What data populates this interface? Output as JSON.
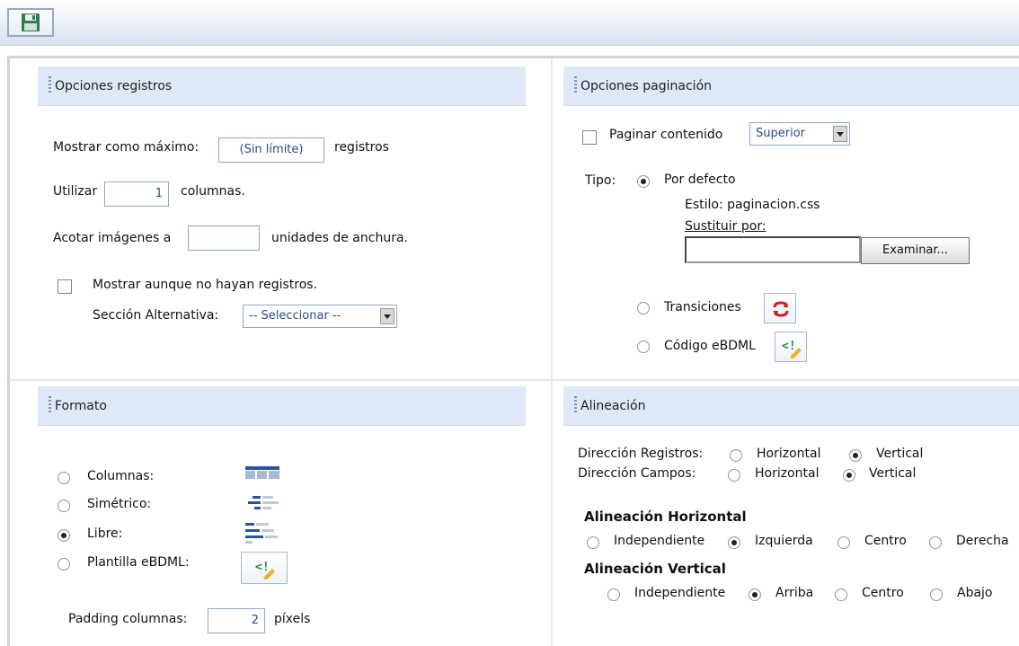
{
  "colors": {
    "header_bg": "#dee8f6",
    "input_text": "#2a4a8a",
    "toolbar_bg": "#e4ebf6"
  },
  "toolbar": {
    "save_icon": "floppy-disk-icon"
  },
  "registros": {
    "title": "Opciones registros",
    "max_label": "Mostrar como máximo:",
    "max_value": "(Sin límite)",
    "max_suffix": "registros",
    "utilizar_label": "Utilizar",
    "columns_value": "1",
    "columns_suffix": "columnas.",
    "acotar_label": "Acotar imágenes a",
    "acotar_value": "",
    "acotar_suffix": "unidades de anchura.",
    "show_empty_label": "Mostrar aunque no hayan registros.",
    "show_empty_checked": false,
    "alt_section_label": "Sección Alternativa:",
    "alt_section_value": "-- Seleccionar --"
  },
  "paginacion": {
    "title": "Opciones paginación",
    "paginar_label": "Paginar contenido",
    "paginar_checked": false,
    "position_value": "Superior",
    "tipo_label": "Tipo:",
    "default_label": "Por defecto",
    "estilo_text": "Estilo: paginacion.css",
    "sustituir_label": "Sustituir por:",
    "file_value": "",
    "browse_label": "Examinar...",
    "transiciones_label": "Transiciones",
    "transiciones_icon": "transitions-icon",
    "codigo_label": "Código eBDML",
    "codigo_icon": "ebdml-code-icon",
    "selected_type": "Por defecto"
  },
  "formato": {
    "title": "Formato",
    "options": [
      {
        "label": "Columnas:",
        "selected": false,
        "icon": "columns-layout-icon"
      },
      {
        "label": "Simétrico:",
        "selected": false,
        "icon": "symmetric-layout-icon"
      },
      {
        "label": "Libre:",
        "selected": true,
        "icon": "free-layout-icon"
      },
      {
        "label": "Plantilla eBDML:",
        "selected": false,
        "icon": "ebdml-template-icon"
      }
    ],
    "padding_label": "Padding columnas:",
    "padding_value": "2",
    "padding_suffix": "píxels"
  },
  "alineacion": {
    "title": "Alineación",
    "dir_registros_label": "Dirección Registros:",
    "dir_campos_label": "Dirección Campos:",
    "horizontal_label": "Horizontal",
    "vertical_label": "Vertical",
    "dir_registros_value": "Vertical",
    "dir_campos_value": "Vertical",
    "h_title": "Alineación Horizontal",
    "h_options": [
      "Independiente",
      "Izquierda",
      "Centro",
      "Derecha"
    ],
    "h_value": "Izquierda",
    "v_title": "Alineación Vertical",
    "v_options": [
      "Independiente",
      "Arriba",
      "Centro",
      "Abajo"
    ],
    "v_value": "Arriba"
  }
}
